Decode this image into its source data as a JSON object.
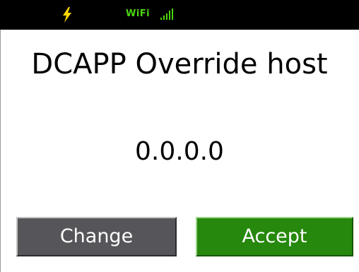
{
  "status_bar": {
    "charging_icon": "lightning-bolt-icon",
    "wifi_label": "WiFi",
    "signal_icon": "signal-bars-icon",
    "colors": {
      "background": "#000000",
      "bolt": "#ffd800",
      "wifi": "#4cd60f"
    }
  },
  "main": {
    "title": "DCAPP Override host",
    "value": "0.0.0.0"
  },
  "buttons": {
    "change_label": "Change",
    "accept_label": "Accept",
    "colors": {
      "change": "#56565a",
      "accept": "#26880c"
    }
  }
}
